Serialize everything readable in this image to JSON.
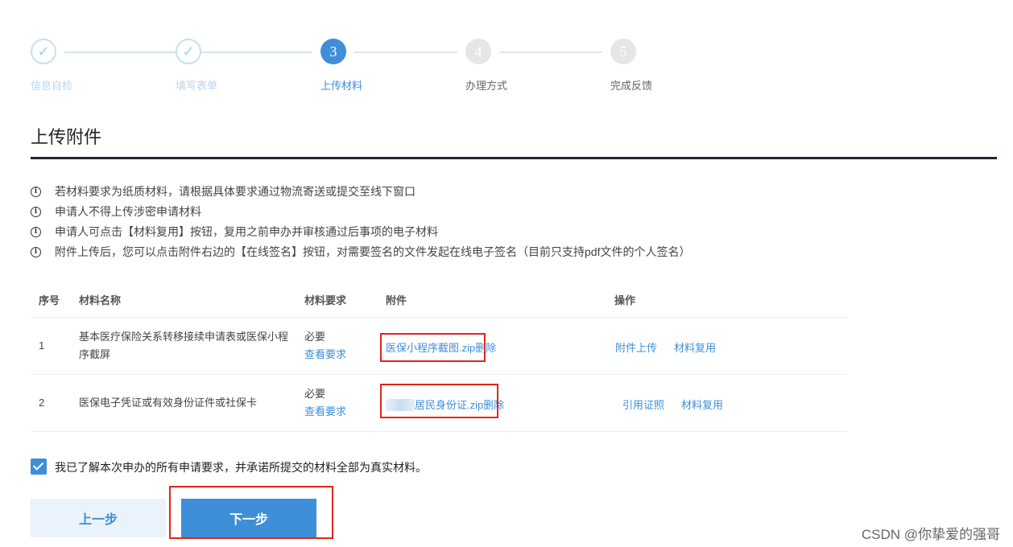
{
  "stepper": {
    "steps": [
      {
        "number": "",
        "label": "信息自检",
        "state": "done"
      },
      {
        "number": "",
        "label": "填写表单",
        "state": "done"
      },
      {
        "number": "3",
        "label": "上传材料",
        "state": "active"
      },
      {
        "number": "4",
        "label": "办理方式",
        "state": "todo"
      },
      {
        "number": "5",
        "label": "完成反馈",
        "state": "todo"
      }
    ],
    "check_glyph": "✓"
  },
  "section": {
    "title": "上传附件"
  },
  "notices": {
    "icon": "info-icon",
    "icon_glyph": "i",
    "items": [
      "若材料要求为纸质材料，请根据具体要求通过物流寄送或提交至线下窗口",
      "申请人不得上传涉密申请材料",
      "申请人可点击【材料复用】按钮，复用之前申办并审核通过后事项的电子材料",
      "附件上传后，您可以点击附件右边的【在线签名】按钮，对需要签名的文件发起在线电子签名（目前只支持pdf文件的个人签名）"
    ]
  },
  "table": {
    "headers": {
      "index": "序号",
      "name": "材料名称",
      "requirement": "材料要求",
      "attachment": "附件",
      "actions": "操作"
    },
    "rows": [
      {
        "index": "1",
        "name": "基本医疗保险关系转移接续申请表或医保小程序截屏",
        "requirement": "必要",
        "view_requirement": "查看要求",
        "file": "医保小程序截图.zip",
        "delete": "删除",
        "action1": "附件上传",
        "action2": "材料复用"
      },
      {
        "index": "2",
        "name": "医保电子凭证或有效身份证件或社保卡",
        "requirement": "必要",
        "view_requirement": "查看要求",
        "file": "居民身份证.zip",
        "delete": "删除",
        "action1": "引用证照",
        "action2": "材料复用"
      }
    ]
  },
  "agreement": {
    "checked": true,
    "text": "我已了解本次申办的所有申请要求，并承诺所提交的材料全部为真实材料。"
  },
  "buttons": {
    "prev": "上一步",
    "next": "下一步"
  },
  "watermark": "CSDN @你挚爱的强哥",
  "colors": {
    "accent": "#3e8fd8",
    "highlight": "#e1251b",
    "rule": "#1e2631"
  }
}
